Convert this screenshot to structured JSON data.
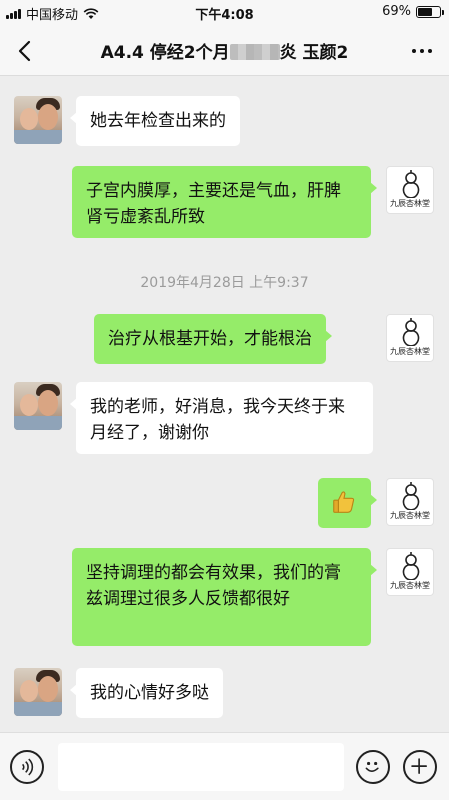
{
  "status_bar": {
    "carrier": "中国移动",
    "time": "下午4:08",
    "battery_percent": "69%",
    "battery_level": 0.69
  },
  "header": {
    "title_before_blur": "A4.4 停经2个月",
    "title_after_blur": "炎  玉颜2"
  },
  "messages": [
    {
      "side": "in",
      "text": "她去年检查出来的"
    },
    {
      "side": "out",
      "text": "子宫内膜厚，主要还是气血，肝脾肾亏虚紊乱所致"
    },
    {
      "side": "out",
      "text": "治疗从根基开始，才能根治"
    },
    {
      "side": "in",
      "text": "我的老师，好消息，我今天终于来月经了，谢谢你"
    },
    {
      "side": "out",
      "sticker": "thumbs-up"
    },
    {
      "side": "out",
      "text": "坚持调理的都会有效果，我们的膏兹调理过很多人反馈都很好"
    },
    {
      "side": "in",
      "text": "我的心情好多哒"
    }
  ],
  "timestamp": "2019年4月28日 上午9:37",
  "shop_avatar": {
    "name": "九辰杏林堂"
  },
  "colors": {
    "outgoing_bubble": "#95ec69",
    "incoming_bubble": "#ffffff",
    "chat_background": "#ededed"
  },
  "icons": {
    "back": "chevron-left-icon",
    "more": "more-dots-icon",
    "voice": "voice-icon",
    "emoji": "emoji-icon",
    "plus": "plus-icon"
  }
}
